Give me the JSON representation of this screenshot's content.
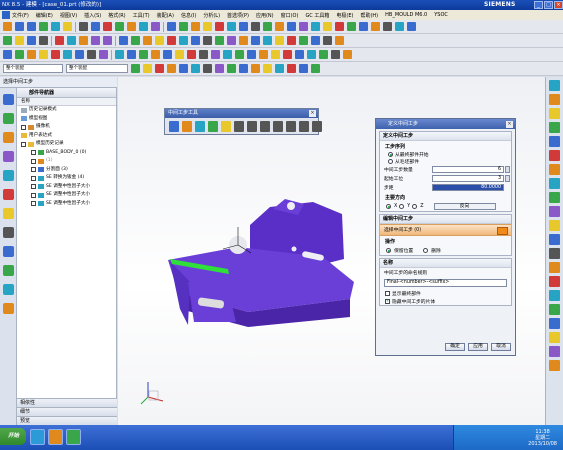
{
  "window": {
    "title": "NX 8.5 - 建模 - [case_01.prt (修改的)]",
    "brand": "SIEMENS"
  },
  "menu": [
    "文件(F)",
    "编辑(E)",
    "视图(V)",
    "插入(S)",
    "格式(R)",
    "工具(T)",
    "装配(A)",
    "信息(I)",
    "分析(L)",
    "首选项(P)",
    "应用(N)",
    "窗口(O)",
    "GC 工具箱",
    "电极(E)",
    "帮助(H)",
    "HB_MOULD M6.0",
    "YSOC"
  ],
  "toolbar": {
    "filter_combo": "整个装配",
    "selection_combo": "整个装配"
  },
  "navigator": {
    "panel_header": "选择中间工步",
    "title": "部件导航器",
    "column": "名称",
    "rows": [
      "历史记录模式",
      "模型视图",
      "摄像机",
      "用户表达式",
      "模型历史记录",
      "BASE_BODY_0 (0)",
      "(1)",
      "分割面 (3)",
      "SE 转换为钣金 (4)",
      "SE 调整中性因子大小",
      "SE 调整中性因子大小",
      "SE 调整中性因子大小"
    ],
    "footer": [
      "相依性",
      "细节",
      "预览"
    ]
  },
  "mid_toolbar": {
    "title": "中间工步工具"
  },
  "dialog": {
    "title": "定义中间工步",
    "section1": "定义中间工步",
    "process_header": "工步序列",
    "radio_from_finished": "从最终部件开始",
    "radio_from_flat": "从毛坯部件",
    "count_label": "中间工步数量",
    "count_value": "6",
    "start_label": "起始工位",
    "start_value": "3",
    "step_label": "步距",
    "step_value": "80.0000",
    "direction_header": "主要方向",
    "dir_x": "X",
    "dir_y": "Y",
    "dir_z": "Z",
    "dir_button": "反向",
    "edit_section": "编辑中间工步",
    "select_step": "选择中间工步 (0)",
    "operation_header": "操作",
    "op_keep": "保留位置",
    "op_delete": "删除",
    "name_section": "名称",
    "rule_label": "中间工步的命名规则",
    "rule_value": "Final-<number>-<suffix>",
    "cb_show_finished": "显示最终部件",
    "cb_hide_previous": "隐藏中间工步的片体",
    "ok": "确定",
    "apply": "应用",
    "cancel": "取消"
  },
  "taskbar": {
    "start": "开始",
    "clock_time": "11:38",
    "clock_day": "星期二",
    "clock_date": "2013/10/08"
  },
  "colors": {
    "part": "#6a3fd8",
    "edge_highlight": "#2fe03a",
    "title_blue": "#1b4fb8"
  }
}
